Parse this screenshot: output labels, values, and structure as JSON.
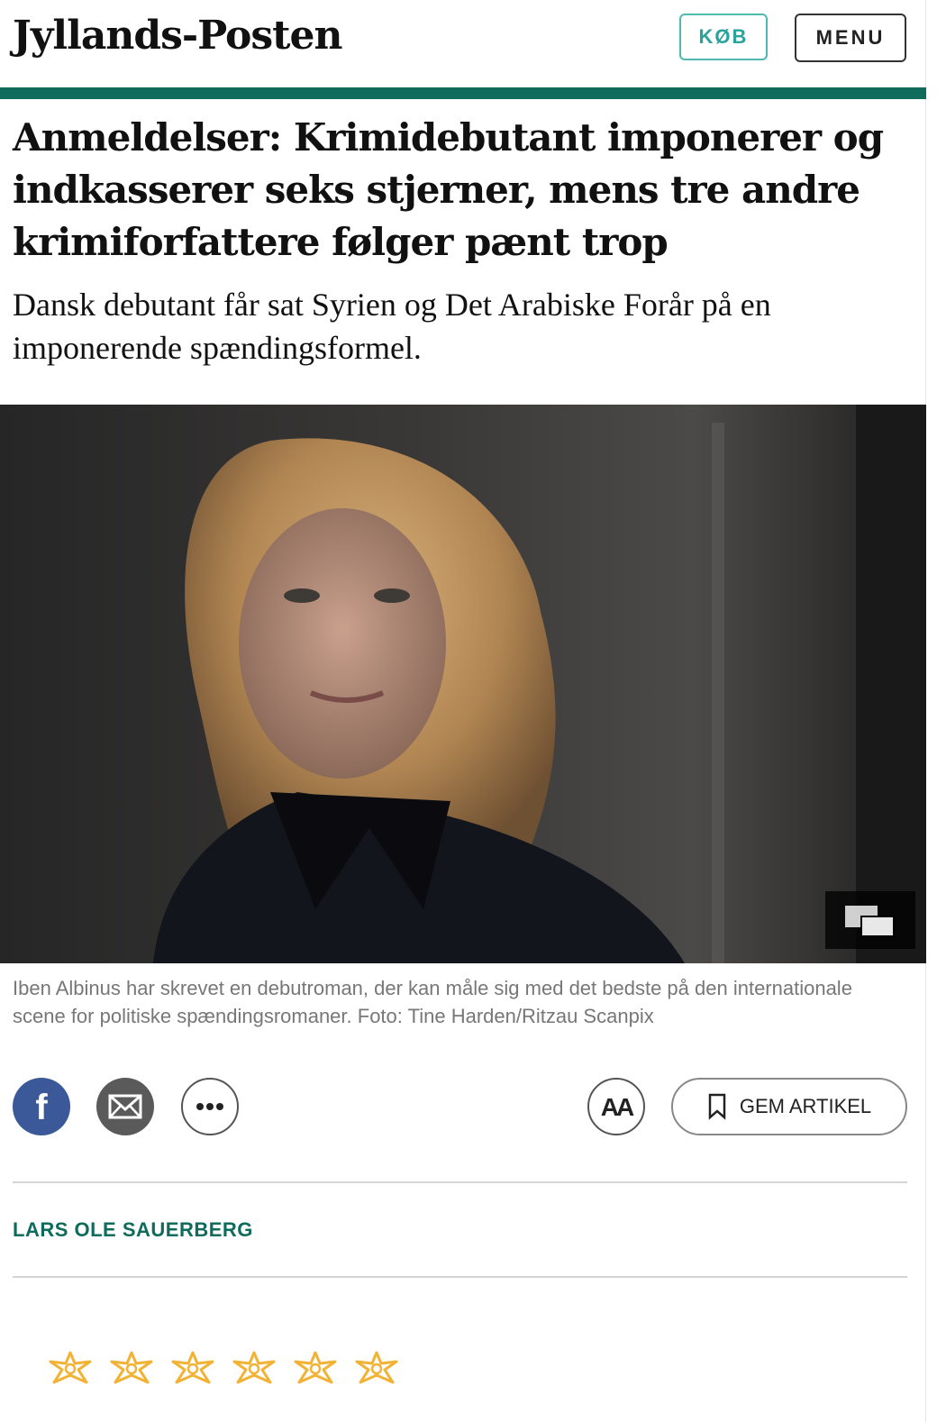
{
  "header": {
    "logo": "Jyllands-Posten",
    "buy_label": "KØB",
    "menu_label": "MENU"
  },
  "article": {
    "headline": "Anmeldelser: Krimidebutant imponerer og indkasserer seks stjerner, mens tre andre krimiforfattere følger pænt trop",
    "subheadline": "Dansk debutant får sat Syrien og Det Arabiske Forår på en imponerende spændingsformel.",
    "caption": "Iben Albinus har skrevet en debutroman, der kan måle sig med det bedste på den internationale scene for politiske spændingsromaner. Foto: Tine Harden/Ritzau Scanpix",
    "author": "LARS OLE SAUERBERG",
    "rating_stars": 6
  },
  "share": {
    "save_label": "GEM ARTIKEL",
    "text_size_label": "AA"
  },
  "icons": {
    "facebook": "facebook-icon",
    "mail": "mail-icon",
    "more": "more-icon",
    "text_size": "text-size-icon",
    "bookmark": "bookmark-icon",
    "gallery": "gallery-icon",
    "star": "star-icon"
  },
  "colors": {
    "accent": "#0f6b5c",
    "buy": "#2aa39a",
    "facebook": "#3b5998",
    "star": "#f2b233"
  }
}
